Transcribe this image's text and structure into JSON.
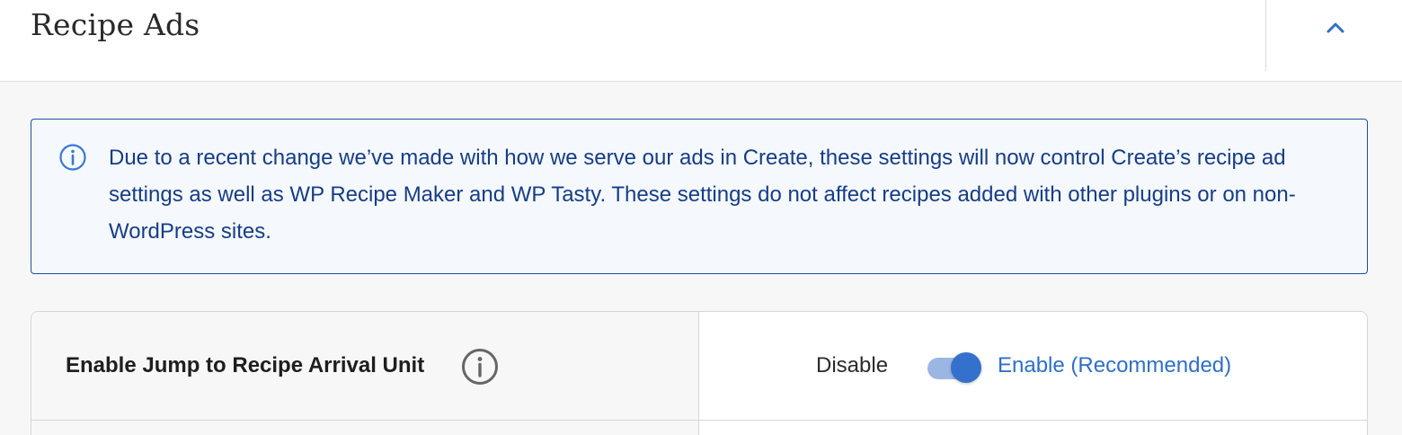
{
  "header": {
    "title": "Recipe Ads",
    "collapse_icon": "chevron-up-icon"
  },
  "notice": {
    "icon": "info-icon",
    "text": "Due to a recent change we’ve made with how we serve our ads in Create, these settings will now control Create’s recipe ad settings as well as WP Recipe Maker and WP Tasty. These settings do not affect recipes added with other plugins or on non-WordPress sites."
  },
  "settings": {
    "rows": [
      {
        "label": "Enable Jump to Recipe Arrival Unit",
        "info_icon": "info-icon",
        "off_label": "Disable",
        "on_label": "Enable (Recommended)",
        "enabled": true
      }
    ]
  },
  "colors": {
    "accent": "#3371cc",
    "notice_border": "#1d4ea3",
    "notice_text": "#163d85",
    "notice_bg": "#f5f9fe"
  }
}
